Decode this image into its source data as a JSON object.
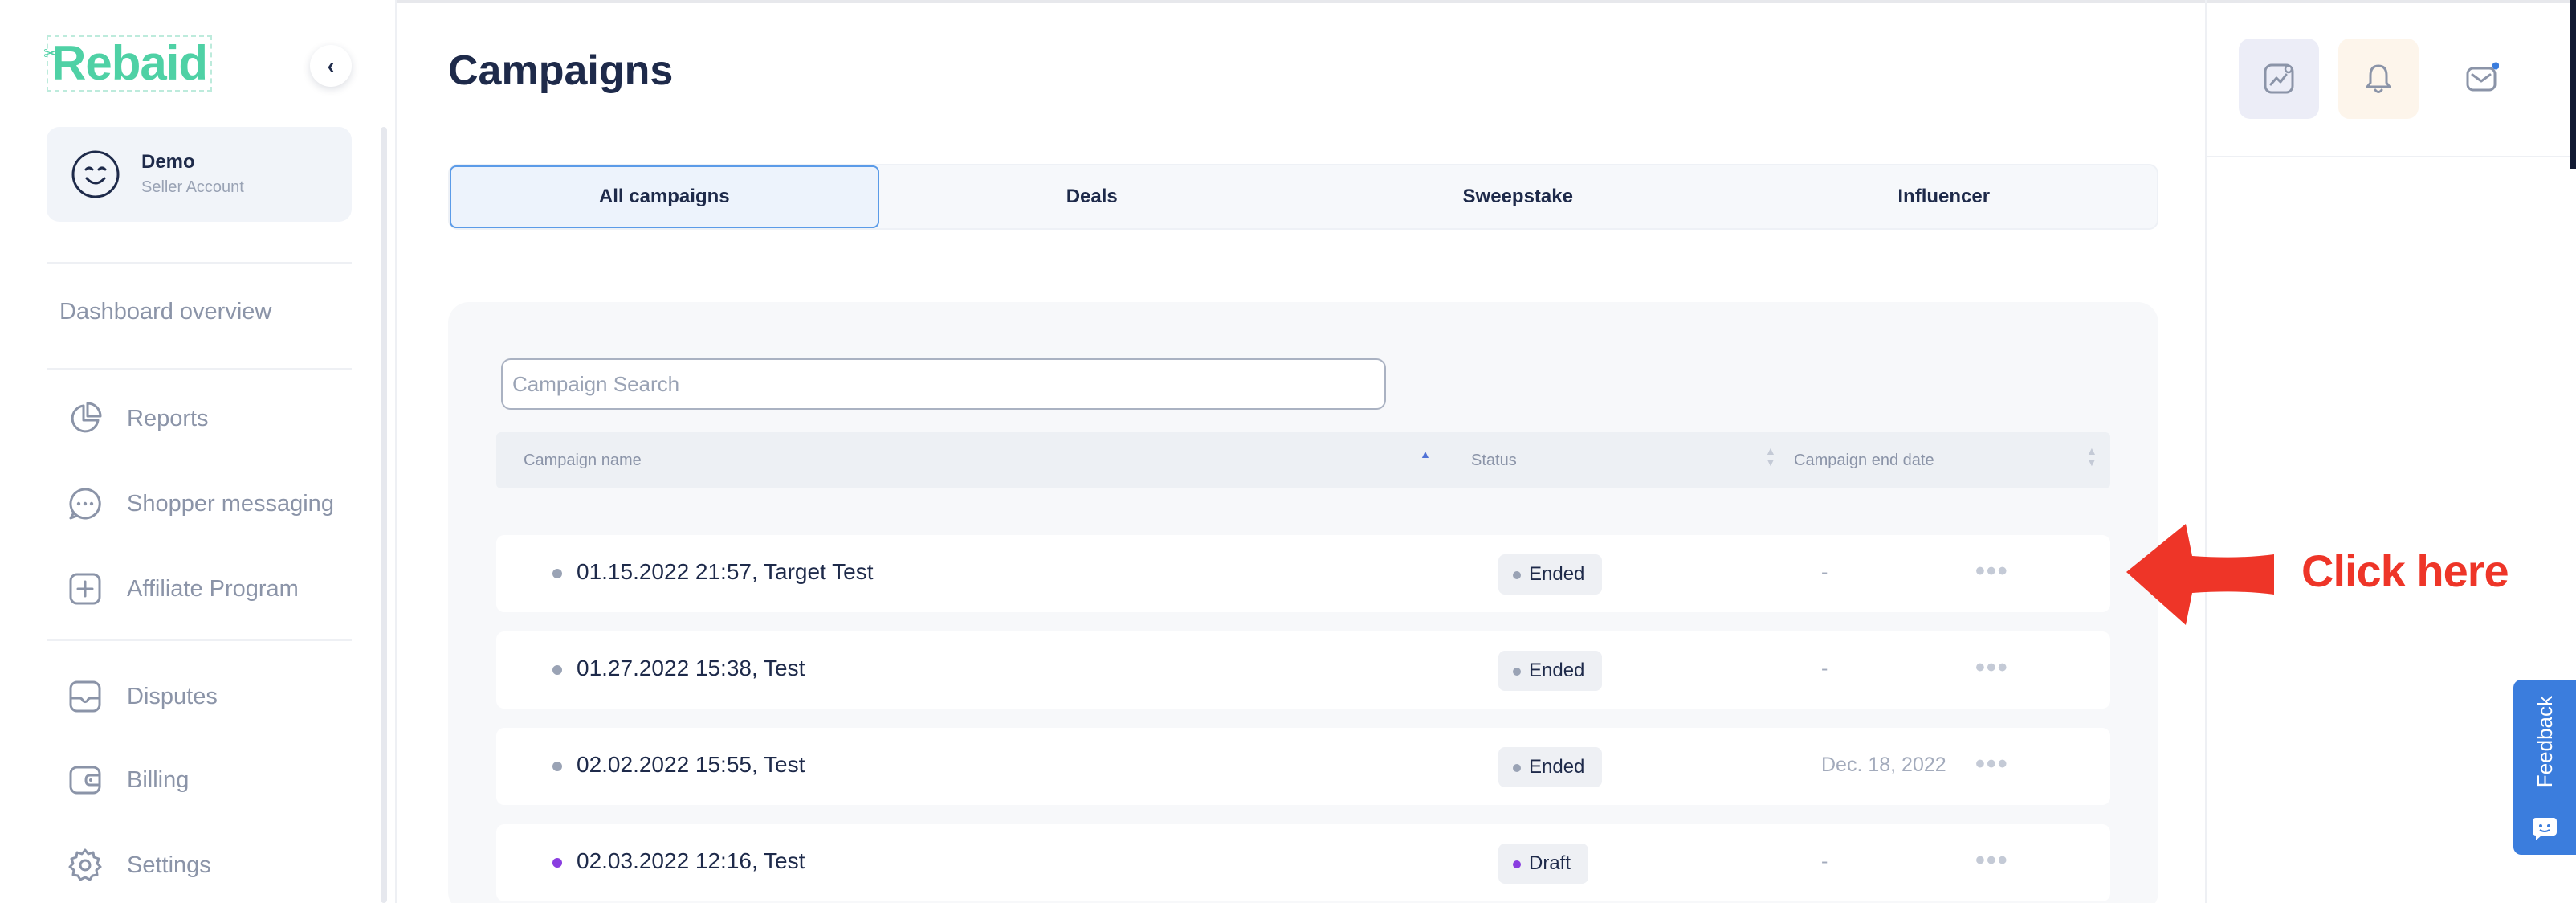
{
  "sidebar": {
    "logo": "Rebaid",
    "account": {
      "name": "Demo",
      "role": "Seller Account"
    },
    "overview": "Dashboard overview",
    "items": [
      {
        "label": "Reports",
        "icon": "pie-chart-icon"
      },
      {
        "label": "Shopper messaging",
        "icon": "chat-bubble-icon"
      },
      {
        "label": "Affiliate Program",
        "icon": "plus-square-icon"
      },
      {
        "label": "Disputes",
        "icon": "folder-icon"
      },
      {
        "label": "Billing",
        "icon": "wallet-icon"
      },
      {
        "label": "Settings",
        "icon": "gear-icon"
      }
    ]
  },
  "main": {
    "title": "Campaigns",
    "tabs": [
      {
        "label": "All campaigns",
        "active": true
      },
      {
        "label": "Deals",
        "active": false
      },
      {
        "label": "Sweepstake",
        "active": false
      },
      {
        "label": "Influencer",
        "active": false
      }
    ],
    "search": {
      "placeholder": "Campaign Search",
      "value": ""
    },
    "table": {
      "columns": [
        "Campaign name",
        "Status",
        "Campaign end date"
      ],
      "rows": [
        {
          "name": "01.15.2022 21:57, Target Test",
          "status": "Ended",
          "end_date": "-"
        },
        {
          "name": "01.27.2022 15:38, Test",
          "status": "Ended",
          "end_date": "-"
        },
        {
          "name": "02.02.2022 15:55, Test",
          "status": "Ended",
          "end_date": "Dec. 18, 2022"
        },
        {
          "name": "02.03.2022 12:16, Test",
          "status": "Draft",
          "end_date": "-"
        }
      ],
      "more_label": "•••"
    }
  },
  "topbar": {
    "icons": [
      "analytics-icon",
      "bell-icon",
      "mail-icon"
    ]
  },
  "annotation": {
    "text": "Click here"
  },
  "feedback": {
    "label": "Feedback"
  },
  "colors": {
    "brand": "#4fd1a5",
    "accent": "#5b9be8",
    "ended_dot": "#9aa3b5",
    "draft_dot": "#8a3ee0",
    "annotation": "#ee3528",
    "feedback": "#3b7ddd"
  }
}
